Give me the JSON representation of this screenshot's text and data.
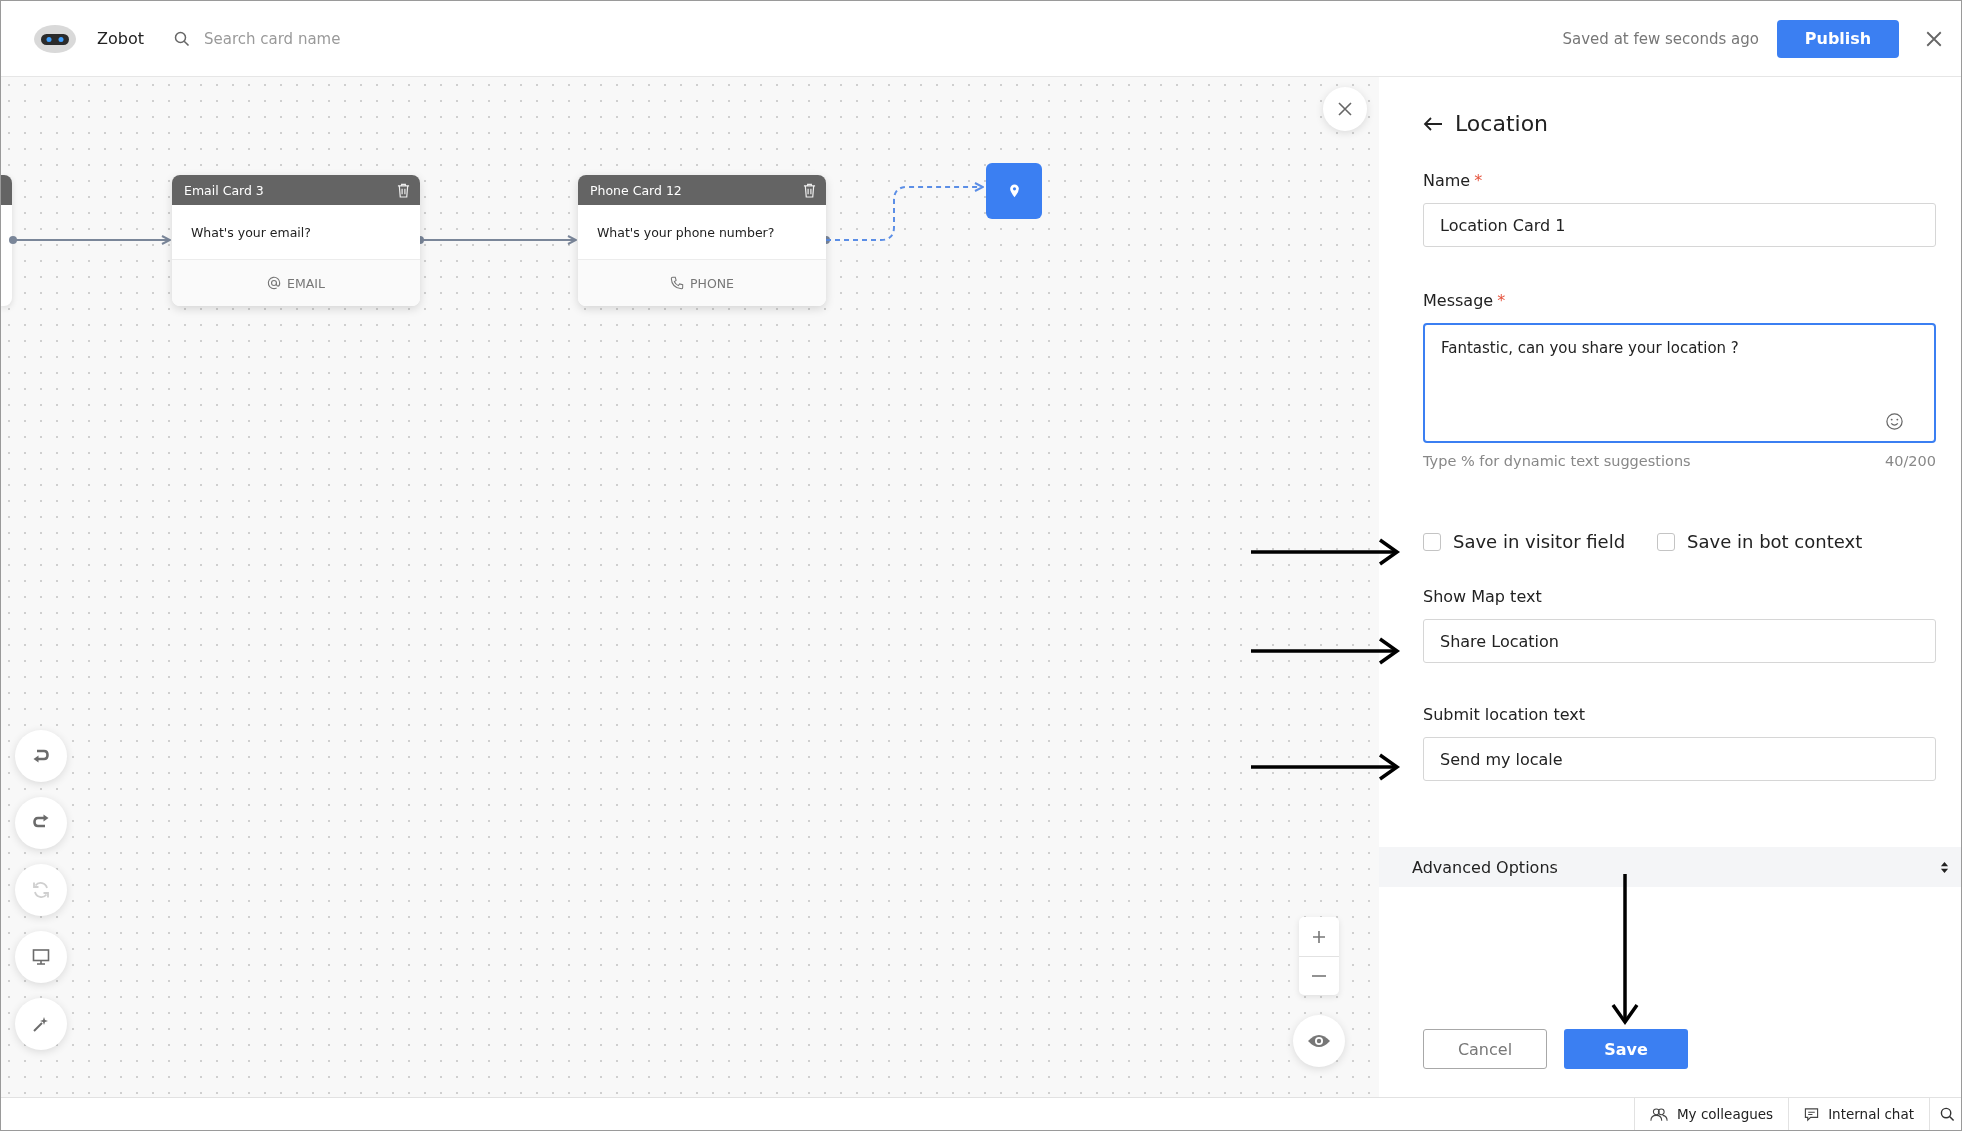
{
  "header": {
    "app_name": "Zobot",
    "search_placeholder": "Search card name",
    "save_status": "Saved at few seconds ago",
    "publish_label": "Publish"
  },
  "canvas": {
    "cards": [
      {
        "title": "Email Card 3",
        "message": "What's your email?",
        "input_label": "EMAIL",
        "kind": "email"
      },
      {
        "title": "Phone Card 12",
        "message": "What's your phone number?",
        "input_label": "PHONE",
        "kind": "phone"
      }
    ],
    "tools": [
      {
        "kind": "undo",
        "disabled": false
      },
      {
        "kind": "redo",
        "disabled": false
      },
      {
        "kind": "refresh",
        "disabled": true
      },
      {
        "kind": "monitor",
        "disabled": false
      },
      {
        "kind": "wand",
        "disabled": false
      }
    ]
  },
  "panel": {
    "title": "Location",
    "name_field": {
      "label": "Name",
      "required_mark": "*",
      "value": "Location Card 1"
    },
    "message_field": {
      "label": "Message",
      "required_mark": "*",
      "value": "Fantastic, can you share your location ?",
      "focused": true,
      "hint": "Type % for dynamic text suggestions",
      "counter": "40/200"
    },
    "checkboxes": [
      {
        "label": "Save in visitor field",
        "checked": false
      },
      {
        "label": "Save in bot context",
        "checked": false
      }
    ],
    "text_fields": [
      {
        "label": "Show Map text",
        "value": "Share Location"
      },
      {
        "label": "Submit location text",
        "value": "Send my locale"
      }
    ],
    "advanced_options": "Advanced Options",
    "cancel_label": "Cancel",
    "save_label": "Save"
  },
  "status_bar": {
    "items": [
      {
        "label": "My colleagues",
        "kind": "colleagues"
      },
      {
        "label": "Internal chat",
        "kind": "chat"
      }
    ]
  }
}
